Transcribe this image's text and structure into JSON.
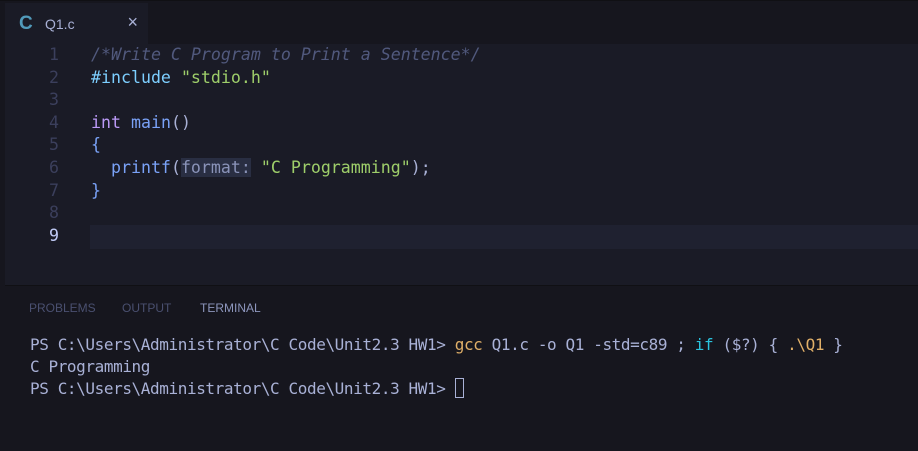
{
  "tab": {
    "icon": "c-language-icon",
    "icon_text": "C",
    "name": "Q1.c",
    "close": "×"
  },
  "editor": {
    "lines": [
      {
        "n": "1",
        "parts": [
          [
            "cmt",
            "/*Write C Program to Print a Sentence*/"
          ]
        ]
      },
      {
        "n": "2",
        "parts": [
          [
            "pre",
            "#include"
          ],
          [
            "punc",
            " "
          ],
          [
            "str",
            "\"stdio.h\""
          ]
        ]
      },
      {
        "n": "3",
        "parts": []
      },
      {
        "n": "4",
        "parts": [
          [
            "kw",
            "int"
          ],
          [
            "punc",
            " "
          ],
          [
            "fn",
            "main"
          ],
          [
            "punc",
            "()"
          ]
        ]
      },
      {
        "n": "5",
        "parts": [
          [
            "brace",
            "{"
          ]
        ]
      },
      {
        "n": "6",
        "parts": [
          [
            "punc",
            "  "
          ],
          [
            "fn",
            "printf"
          ],
          [
            "punc",
            "("
          ],
          [
            "hint",
            "format:"
          ],
          [
            "punc",
            " "
          ],
          [
            "str",
            "\"C Programming\""
          ],
          [
            "punc",
            ");"
          ]
        ]
      },
      {
        "n": "7",
        "parts": [
          [
            "brace",
            "}"
          ]
        ]
      },
      {
        "n": "8",
        "parts": []
      },
      {
        "n": "9",
        "parts": []
      }
    ],
    "current_line": "9"
  },
  "panel": {
    "tabs": [
      "PROBLEMS",
      "OUTPUT",
      "TERMINAL"
    ],
    "active": "TERMINAL"
  },
  "terminal": {
    "prompt": "PS C:\\Users\\Administrator\\C Code\\Unit2.3 HW1> ",
    "cmd_gcc": "gcc",
    "cmd_rest": " Q1.c -o Q1 -std=c89 ; ",
    "cmd_if": "if",
    "cmd_cond": " ($?) { ",
    "cmd_run": ".\\Q1",
    "cmd_end": " }",
    "output": "C Programming",
    "prompt2": "PS C:\\Users\\Administrator\\C Code\\Unit2.3 HW1> "
  }
}
